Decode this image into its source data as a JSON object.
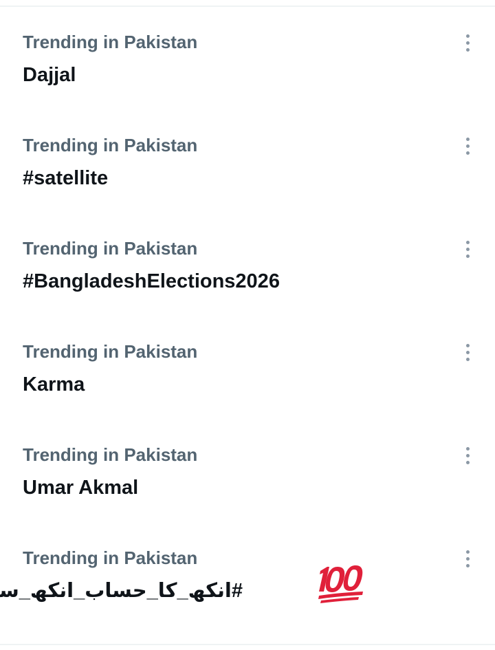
{
  "trends": [
    {
      "context": "Trending in Pakistan",
      "name": "Dajjal"
    },
    {
      "context": "Trending in Pakistan",
      "name": "#satellite"
    },
    {
      "context": "Trending in Pakistan",
      "name": "#BangladeshElections2026"
    },
    {
      "context": "Trending in Pakistan",
      "name": "Karma"
    },
    {
      "context": "Trending in Pakistan",
      "name": "Umar Akmal"
    },
    {
      "context": "Trending in Pakistan",
      "name": "#انکھ_کا_حساب_انکھ_سے",
      "emoji": "hundred-points-icon"
    }
  ],
  "icons": {
    "more": "more-vertical-icon"
  },
  "colors": {
    "context_text": "#536471",
    "name_text": "#0f1419",
    "more_dots": "#8b98a5",
    "divider": "#eff3f4",
    "emoji_red": "#e0203a"
  }
}
